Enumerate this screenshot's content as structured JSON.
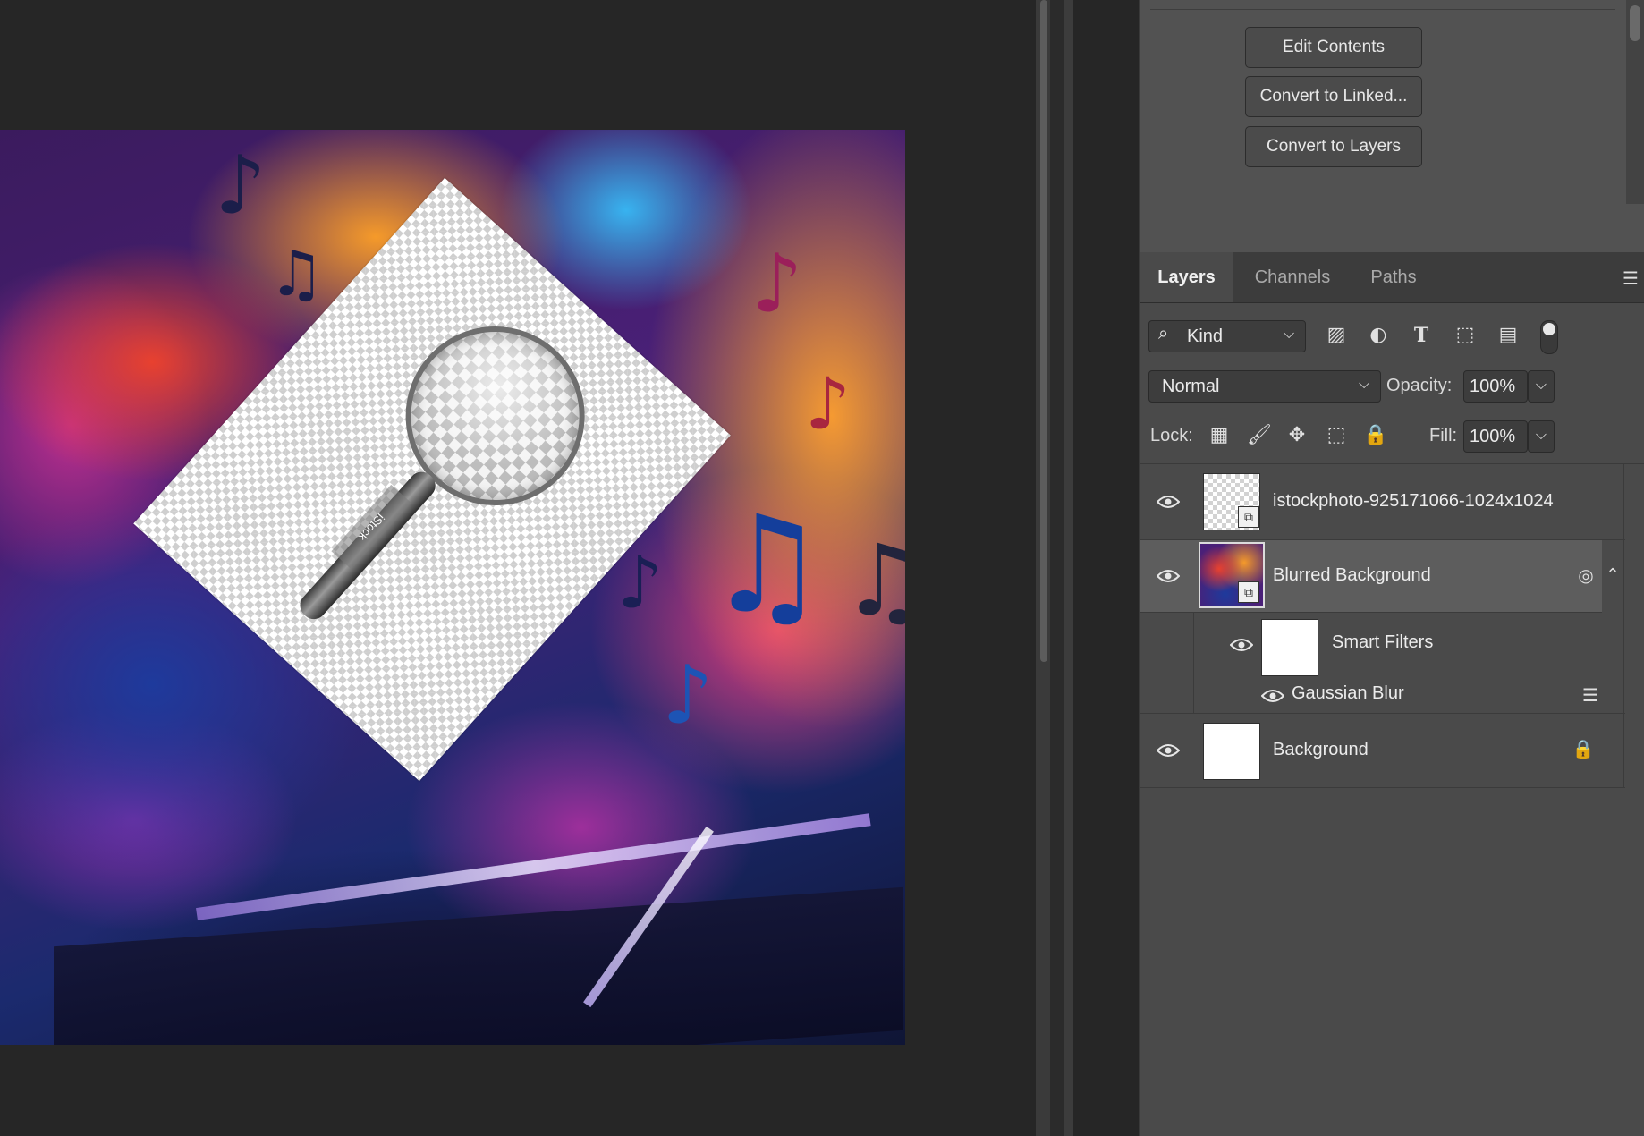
{
  "properties": {
    "buttons": [
      "Edit Contents",
      "Convert to Linked...",
      "Convert to Layers"
    ]
  },
  "canvas": {
    "placed_watermark": "iStock"
  },
  "layers_panel": {
    "tabs": [
      "Layers",
      "Channels",
      "Paths"
    ],
    "filter_kind": "Kind",
    "blend_mode": "Normal",
    "opacity_label": "Opacity:",
    "opacity_value": "100%",
    "lock_label": "Lock:",
    "fill_label": "Fill:",
    "fill_value": "100%",
    "layers": [
      {
        "name": "istockphoto-925171066-1024x1024",
        "visible": true
      },
      {
        "name": "Blurred Background",
        "visible": true,
        "selected": true
      },
      {
        "name": "Smart Filters",
        "visible": true
      },
      {
        "name": "Gaussian Blur",
        "visible": true
      },
      {
        "name": "Background",
        "visible": true,
        "locked": true
      }
    ]
  },
  "icons": {
    "filter_pixel": "image-icon",
    "filter_adjustment": "adjustment-icon",
    "filter_type": "type-icon",
    "filter_shape": "shape-icon",
    "filter_smart": "smart-object-icon",
    "lock_pixels": "checkerboard-icon",
    "lock_paint": "brush-icon",
    "lock_position": "move-icon",
    "lock_artboard": "artboard-icon",
    "lock_all": "lock-icon"
  }
}
